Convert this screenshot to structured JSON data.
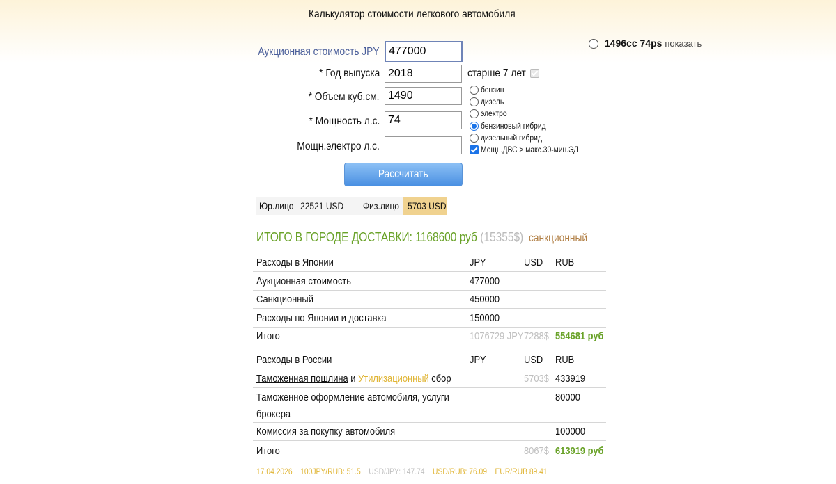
{
  "title": "Калькулятор стоимости легкового автомобиля",
  "engine_info": {
    "bold": "1496cc 74ps",
    "link": "показать"
  },
  "form": {
    "auction_label": "Аукционная стоимость JPY",
    "auction_value": "477000",
    "year_label": "* Год выпуска",
    "year_value": "2018",
    "age_label": "старше 7 лет",
    "volume_label": "* Объем куб.см.",
    "volume_value": "1490",
    "power_label": "* Мощность л.с.",
    "power_value": "74",
    "epower_label": "Мощн.электро л.с.",
    "epower_value": "",
    "fuel_options": [
      "бензин",
      "дизель",
      "электро",
      "бензиновый гибрид",
      "дизельный гибрид"
    ],
    "fuel_selected": "бензиновый гибрид",
    "hybrid_check_label": "Мощн.ДВС > макс.30-мин.ЭД",
    "calc_button": "Рассчитать"
  },
  "summary": {
    "legal_label": "Юр.лицо",
    "legal_value": "22521 USD",
    "person_label": "Физ.лицо",
    "person_value": "5703 USD"
  },
  "total": {
    "label": "ИТОГО В ГОРОДЕ ДОСТАВКИ: 1168600 руб",
    "usd": "(15355$)",
    "tag": "санкционный"
  },
  "japan": {
    "header": [
      "Расходы в Японии",
      "JPY",
      "USD",
      "RUB"
    ],
    "rows": [
      [
        "Аукционная стоимость",
        "477000"
      ],
      [
        "Санкционный",
        "450000"
      ],
      [
        "Расходы по Японии и доставка",
        "150000"
      ]
    ],
    "total": {
      "label": "Итого",
      "jpy": "1076729 JPY",
      "usd": "7288$",
      "rub": "554681 руб"
    }
  },
  "russia": {
    "header": [
      "Расходы в России",
      "JPY",
      "USD",
      "RUB"
    ],
    "duty": {
      "part1": "Таможенная пошлина",
      "and": " и ",
      "part2": "Утилизационный",
      "part3": " сбор",
      "usd": "5703$",
      "rub": "433919"
    },
    "clearance": {
      "line1": "Таможенное оформление автомобиля, услуги",
      "line2": "брокера",
      "rub": "80000"
    },
    "commission": {
      "label": "Комиссия за покупку автомобиля",
      "rub": "100000"
    },
    "total": {
      "label": "Итого",
      "usd": "8067$",
      "rub": "613919 руб"
    }
  },
  "rates": {
    "date": "17.04.2026",
    "jpyrub": "100JPY/RUB: 51.5",
    "usdjpy": "USD/JPY: 147.74",
    "usdrub": "USD/RUB: 76.09",
    "eurrub": "EUR/RUB 89.41"
  }
}
